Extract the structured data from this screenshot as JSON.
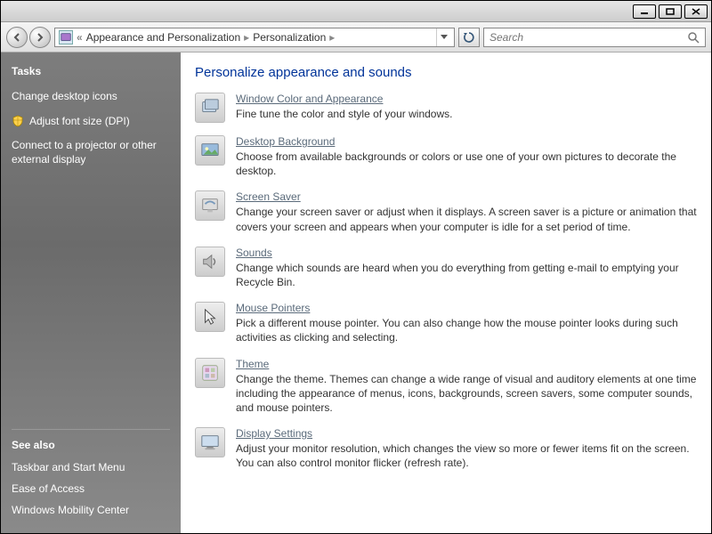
{
  "titlebar": {
    "min_label": "minimize",
    "max_label": "maximize",
    "close_label": "close"
  },
  "breadcrumb": {
    "back_prefix": "«",
    "parent": "Appearance and Personalization",
    "current": "Personalization"
  },
  "search": {
    "placeholder": "Search"
  },
  "sidebar": {
    "tasks_header": "Tasks",
    "tasks": [
      {
        "label": "Change desktop icons",
        "shield": false
      },
      {
        "label": "Adjust font size (DPI)",
        "shield": true
      },
      {
        "label": "Connect to a projector or other external display",
        "shield": false
      }
    ],
    "seealso_header": "See also",
    "seealso": [
      {
        "label": "Taskbar and Start Menu"
      },
      {
        "label": "Ease of Access"
      },
      {
        "label": "Windows Mobility Center"
      }
    ]
  },
  "main": {
    "heading": "Personalize appearance and sounds",
    "entries": [
      {
        "icon": "window-color-icon",
        "title": "Window Color and Appearance",
        "desc": "Fine tune the color and style of your windows."
      },
      {
        "icon": "desktop-background-icon",
        "title": "Desktop Background",
        "desc": "Choose from available backgrounds or colors or use one of your own pictures to decorate the desktop."
      },
      {
        "icon": "screen-saver-icon",
        "title": "Screen Saver",
        "desc": "Change your screen saver or adjust when it displays. A screen saver is a picture or animation that covers your screen and appears when your computer is idle for a set period of time."
      },
      {
        "icon": "sounds-icon",
        "title": "Sounds",
        "desc": "Change which sounds are heard when you do everything from getting e-mail to emptying your Recycle Bin."
      },
      {
        "icon": "mouse-pointers-icon",
        "title": "Mouse Pointers",
        "desc": "Pick a different mouse pointer. You can also change how the mouse pointer looks during such activities as clicking and selecting."
      },
      {
        "icon": "theme-icon",
        "title": "Theme",
        "desc": "Change the theme. Themes can change a wide range of visual and auditory elements at one time including the appearance of menus, icons, backgrounds, screen savers, some computer sounds, and mouse pointers."
      },
      {
        "icon": "display-settings-icon",
        "title": "Display Settings",
        "desc": "Adjust your monitor resolution, which changes the view so more or fewer items fit on the screen. You can also control monitor flicker (refresh rate)."
      }
    ]
  }
}
